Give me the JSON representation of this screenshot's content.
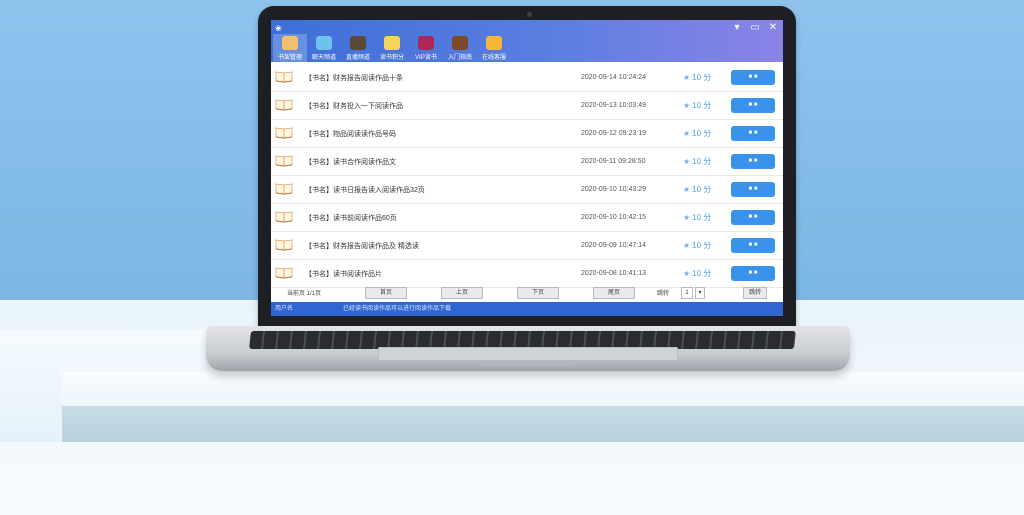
{
  "app": {
    "logo": "❀",
    "toolbar": [
      {
        "label": "书架管理",
        "icon": "rabbit-icon",
        "color": "#f0c070",
        "active": true
      },
      {
        "label": "聊天频道",
        "icon": "globe-icon",
        "color": "#6fc2ee"
      },
      {
        "label": "直播频道",
        "icon": "board-icon",
        "color": "#5a4a3a"
      },
      {
        "label": "读书积分",
        "icon": "gift-icon",
        "color": "#f6d35a"
      },
      {
        "label": "VIP读书",
        "icon": "vip-icon",
        "color": "#b0255a"
      },
      {
        "label": "入门指南",
        "icon": "book-icon",
        "color": "#7a4a2a"
      },
      {
        "label": "在线客服",
        "icon": "sun-icon",
        "color": "#f7b733"
      }
    ],
    "window_controls": [
      "▾",
      "▭",
      "✕"
    ]
  },
  "rows": [
    {
      "title": "【书名】财务报告阅读作品十条",
      "date": "2020-09-14  10:24:24",
      "score": "10 分",
      "button": "■ ■"
    },
    {
      "title": "【书名】财务投入一下阅读作品",
      "date": "2020-09-13  10:03:49",
      "score": "10 分",
      "button": "■ ■"
    },
    {
      "title": "【书名】物品阅读读作品号码",
      "date": "2020-09-12  09:23:19",
      "score": "10 分",
      "button": "■ ■"
    },
    {
      "title": "【书名】读书合作阅读作品文",
      "date": "2020-09-11  09:28:50",
      "score": "10 分",
      "button": "■ ■"
    },
    {
      "title": "【书名】读书日报告读入阅读作品32页",
      "date": "2020-09-10  10:43:29",
      "score": "10 分",
      "button": "■ ■"
    },
    {
      "title": "【书名】读书前阅读作品60页",
      "date": "2020-09-10  10:42:15",
      "score": "10 分",
      "button": "■ ■"
    },
    {
      "title": "【书名】财务报告阅读作品及  精选读",
      "date": "2020-09-09  10:47:14",
      "score": "10 分",
      "button": "■ ■"
    },
    {
      "title": "【书名】读书阅读作品片",
      "date": "2020-09-08  10:41:13",
      "score": "10 分",
      "button": "■ ■"
    }
  ],
  "pager": {
    "info": "当前页  1/1页",
    "first": "首页",
    "prev": "上页",
    "next": "下页",
    "last": "尾页",
    "goto_label": "跳转",
    "page_value": "1",
    "go": "跳转"
  },
  "status": {
    "left": "用户名",
    "right": "已经读书阅读作品可以进行阅读作品下载"
  }
}
